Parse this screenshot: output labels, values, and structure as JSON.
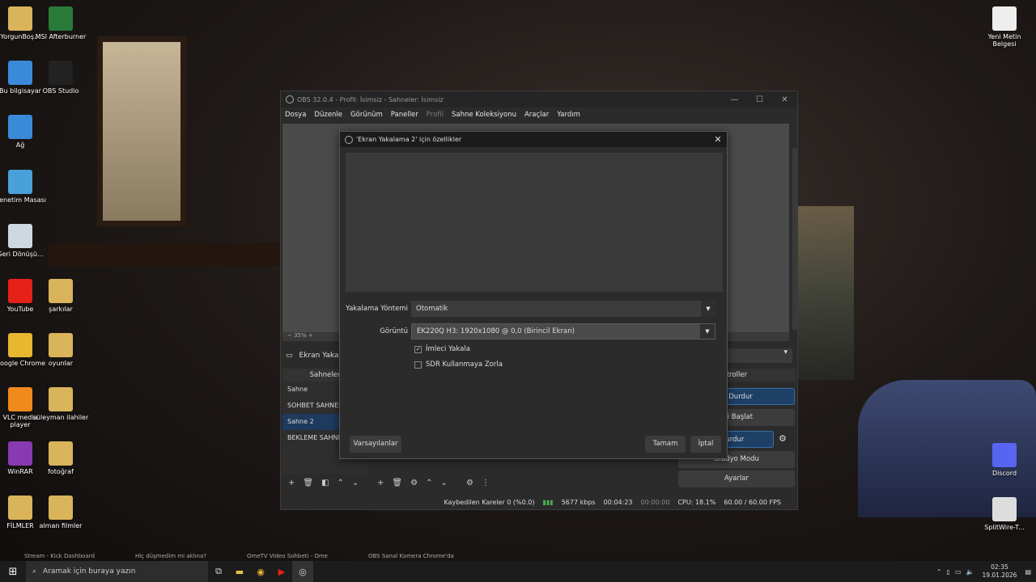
{
  "desktop": {
    "left_icons": [
      {
        "label": "YorgunBoş...",
        "color": "#d9b45a"
      },
      {
        "label": "MSI Afterburner",
        "color": "#2a7a3a"
      },
      {
        "label": "Bu bilgisayar",
        "color": "#3a8ad9"
      },
      {
        "label": "OBS Studio",
        "color": "#222222"
      },
      {
        "label": "Ağ",
        "color": "#3a8ad9"
      },
      {
        "label": "Denetim Masası",
        "color": "#4aa0d9"
      },
      {
        "label": "Geri Dönüşü...",
        "color": "#cfd8df"
      },
      {
        "label": "YouTube",
        "color": "#e62117"
      },
      {
        "label": "şarkılar",
        "color": "#d9b45a"
      },
      {
        "label": "Google Chrome",
        "color": "#e8b730"
      },
      {
        "label": "oyunlar",
        "color": "#d9b45a"
      },
      {
        "label": "VLC media player",
        "color": "#f08a1c"
      },
      {
        "label": "süleyman ilahiler",
        "color": "#d9b45a"
      },
      {
        "label": "WinRAR",
        "color": "#8a3ab0"
      },
      {
        "label": "fotoğraf",
        "color": "#d9b45a"
      },
      {
        "label": "FİLMLER",
        "color": "#d9b45a"
      },
      {
        "label": "alman filmler",
        "color": "#d9b45a"
      }
    ],
    "right_icons": [
      {
        "label": "Yeni Metin Belgesi",
        "color": "#eeeeee"
      },
      {
        "label": "Discord",
        "color": "#5865f2"
      },
      {
        "label": "SplitWire-T...",
        "color": "#dddddd"
      }
    ]
  },
  "obs": {
    "title": "OBS 32.0.4 - Profil: İsimsiz - Sahneler: İsimsiz",
    "menu": [
      "Dosya",
      "Düzenle",
      "Görünüm",
      "Paneller",
      "Profil",
      "Sahne Koleksiyonu",
      "Araçlar",
      "Yardım"
    ],
    "zoom": "35%",
    "source_label": "Ekran Yakala",
    "scenes_header": "Sahneler",
    "controls_header": "troller",
    "scenes": [
      "Sahne",
      "SOHBET SAHNESİ",
      "Sahne 2",
      "BEKLEME SAHNESİ"
    ],
    "controls": [
      "yı Durdur",
      "rdi Başlat",
      "ayı Durdur",
      "Stüdyo Modu",
      "Ayarlar"
    ],
    "status": {
      "dropped": "Kaybedilen Kareler 0 (%0.0)",
      "bitrate": "5677 kbps",
      "rec_time": "00:04:23",
      "stream_time": "00:00:00",
      "cpu": "CPU: 18.1%",
      "fps": "60.00 / 60.00 FPS"
    }
  },
  "dialog": {
    "title": "'Ekran Yakalama 2' için özellikler",
    "method_label": "Yakalama Yöntemi",
    "method_value": "Otomatik",
    "display_label": "Görüntü",
    "display_value": "EK220Q H3: 1920x1080 @ 0,0 (Birincil Ekran)",
    "cursor_label": "İmleci Yakala",
    "cursor_checked": true,
    "sdr_label": "SDR Kullanmaya Zorla",
    "sdr_checked": false,
    "defaults_btn": "Varsayılanlar",
    "ok_btn": "Tamam",
    "cancel_btn": "İptal"
  },
  "browser_tabs": [
    "Stream - Kick Dashboard",
    "Hiç düşmedim mi aklına?",
    "OmeTV Video Sohbeti - Ome",
    "OBS Sanal Kamera Chrome'da"
  ],
  "taskbar": {
    "search_placeholder": "Aramak için buraya yazın",
    "time": "02:35",
    "date": "19.01.2026"
  }
}
